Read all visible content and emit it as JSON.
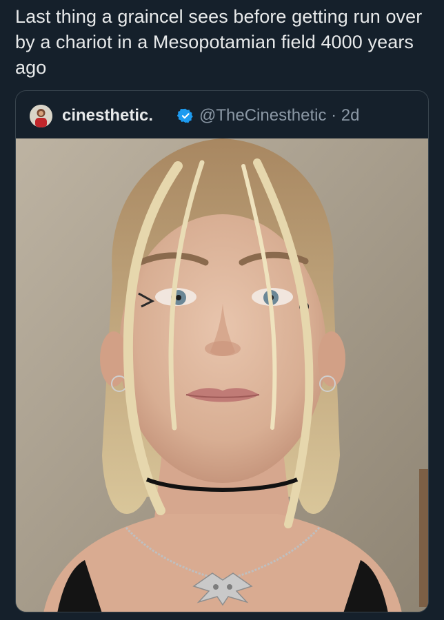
{
  "tweet": {
    "text": "Last thing a graincel sees before getting run over by a chariot in a Mesopotamian field 4000 years ago"
  },
  "quoted_tweet": {
    "display_name": "cinesthetic.",
    "handle": "@TheCinesthetic",
    "separator": "·",
    "age": "2d",
    "verified": true,
    "avatar_icon": "profile-avatar",
    "media": "photo-portrait"
  },
  "colors": {
    "background": "#15202b",
    "text": "#e7e9ea",
    "secondary_text": "#8b98a5",
    "verified_badge": "#1d9bf0",
    "card_border": "#38444d"
  }
}
